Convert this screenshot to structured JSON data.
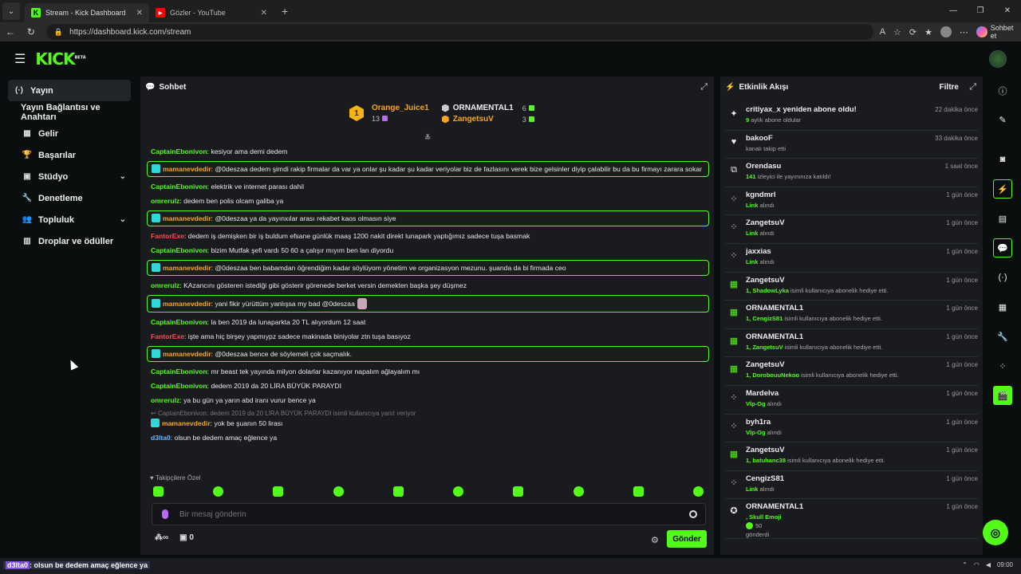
{
  "browser": {
    "tabs": [
      {
        "title": "Stream - Kick Dashboard",
        "active": true,
        "icon": "kick-icon"
      },
      {
        "title": "Gözler - YouTube",
        "active": false,
        "icon": "youtube-icon"
      }
    ],
    "url": "https://dashboard.kick.com/stream",
    "copilot_label": "Sohbet et"
  },
  "header": {
    "logo": "KICK",
    "logo_sup": "BETA"
  },
  "sidebar": {
    "items": [
      {
        "label": "Yayın",
        "icon": "broadcast-icon"
      },
      {
        "label": "Yayın Bağlantısı ve Anahtarı",
        "icon": ""
      },
      {
        "label": "Gelir",
        "icon": "revenue-icon"
      },
      {
        "label": "Başarılar",
        "icon": "trophy-icon"
      },
      {
        "label": "Stüdyo",
        "icon": "studio-icon"
      },
      {
        "label": "Denetleme",
        "icon": "wrench-icon"
      },
      {
        "label": "Topluluk",
        "icon": "community-icon"
      },
      {
        "label": "Droplar ve ödüller",
        "icon": "drops-icon"
      }
    ]
  },
  "chat": {
    "title": "Sohbet",
    "leaderboard": {
      "first": {
        "rank": "1",
        "name": "Orange_Juice1",
        "count": "13"
      },
      "second": {
        "name": "ORNAMENTAL1",
        "count": "6"
      },
      "third": {
        "name": "ZangetsuV",
        "count": "3"
      }
    },
    "messages": [
      {
        "user": "CaptainEbonivon",
        "text": ": kesiyor ama demi dedem"
      },
      {
        "user": "mamanevdedir",
        "text": ": @0deszaa dedem şimdi rakip firmalar da var ya onlar şu kadar şu kadar veriyolar biz de fazlasını verek bize gelsinler diyip çalabilir bu da bu firmayı zarara sokar"
      },
      {
        "user": "CaptainEbonivon",
        "text": ": elektrik ve internet parası dahil"
      },
      {
        "user": "omreruIz",
        "text": ": dedem ben polis olcam galiba ya"
      },
      {
        "user": "mamanevdedir",
        "text": ": @0deszaa ya da yayınxılar arası rekabet kaos olmasın siye"
      },
      {
        "user": "FantorExe",
        "text": ": dedem iş demişken bir iş buldum efsane günlük maaş 1200 nakit direkt lunapark yaptığımız sadece tuşa basmak"
      },
      {
        "user": "CaptainEbonivon",
        "text": ": bizim Mutfak şefi vardı 50 60 a çalışır mıyım ben lan diyordu"
      },
      {
        "user": "mamanevdedir",
        "text": ": @0deszaa ben babamdan öğrendiğim kadar söylüyom yönetim ve organizasyon mezunu. şuanda da bi firmada ceo"
      },
      {
        "user": "omreruIz",
        "text": ": KAzancını gösteren istediği gibi gösterir görenede berket versin demekten başka şey düşmez"
      },
      {
        "user": "mamanevdedir",
        "text": ": yani fikir yürüttüm yanlışsa my bad @0deszaa"
      },
      {
        "user": "CaptainEbonivon",
        "text": ": la ben 2019 da lunaparkta 20 TL alıyordum 12 saat"
      },
      {
        "user": "FantorExe",
        "text": ": işte ama hiç birşey yapmıypz sadece makinada biniyolar ztn tuşa basıyoz"
      },
      {
        "user": "mamanevdedir",
        "text": ": @0deszaa bence de söylemeli çok saçmalık."
      },
      {
        "user": "CaptainEbonivon",
        "text": ": mr beast tek yayında milyon dolarlar kazanıyor napalım ağlayalım mı"
      },
      {
        "user": "CaptainEbonivon",
        "text": ": dedem 2019 da 20 LİRA BÜYÜK PARAYDI"
      },
      {
        "user": "omreruIz",
        "text": ": ya bu gün ya yarın abd iranı vurur bence ya"
      },
      {
        "reply": "CaptainEbonivon: dedem 2019 da 20 LİRA BÜYÜK PARAYDI isimli kullanıcıya yanıt veriyor",
        "user": "mamanevdedir",
        "text": ": yok be şuanın 50 lirası"
      },
      {
        "user": "d3lta0",
        "text": ": olsun be dedem amaç eğlence ya"
      }
    ],
    "followers_only": "Takipçilere Özel",
    "input_placeholder": "Bir mesaj gönderin",
    "footer_count": "0",
    "send_label": "Gönder"
  },
  "activity": {
    "title": "Etkinlik Akışı",
    "filter": "Filtre",
    "items": [
      {
        "name": "critiyax_x yeniden abone oldu!",
        "time": "22 dakika önce",
        "hl": "9",
        "desc": " aylık abone oldular",
        "icon": "sparkle-icon"
      },
      {
        "name": "bakooF",
        "time": "33 dakika önce",
        "hl": "",
        "desc": "kanalı takip etti",
        "icon": "heart-icon"
      },
      {
        "name": "Orendasu",
        "time": "1 saat önce",
        "hl": "141",
        "desc": " izleyici ile yayınınıza katıldı!",
        "icon": "raid-icon"
      },
      {
        "name": "kgndmrl",
        "time": "1 gün önce",
        "hl": "Link",
        "desc": " alındı",
        "icon": "reward-icon"
      },
      {
        "name": "ZangetsuV",
        "time": "1 gün önce",
        "hl": "Link",
        "desc": " alındı",
        "icon": "reward-icon"
      },
      {
        "name": "jaxxias",
        "time": "1 gün önce",
        "hl": "Link",
        "desc": " alındı",
        "icon": "reward-icon"
      },
      {
        "name": "ZangetsuV",
        "time": "1 gün önce",
        "hl": "1, ShadowLyka",
        "desc": " isimli kullanıcıya abonelik hediye etti.",
        "icon": "gift-icon"
      },
      {
        "name": "ORNAMENTAL1",
        "time": "1 gün önce",
        "hl": "1, CengizS81",
        "desc": " isimli kullanıcıya abonelik hediye etti.",
        "icon": "gift-icon"
      },
      {
        "name": "ORNAMENTAL1",
        "time": "1 gün önce",
        "hl": "1, ZangetsuV",
        "desc": " isimli kullanıcıya abonelik hediye etti.",
        "icon": "gift-icon"
      },
      {
        "name": "ZangetsuV",
        "time": "1 gün önce",
        "hl": "1, DorobouuNekoo",
        "desc": " isimli kullanıcıya abonelik hediye etti.",
        "icon": "gift-icon"
      },
      {
        "name": "Mardelva",
        "time": "1 gün önce",
        "hl": "Vİp-Og",
        "desc": " alındı",
        "icon": "reward-icon"
      },
      {
        "name": "byh1ra",
        "time": "1 gün önce",
        "hl": "Vİp-Og",
        "desc": " alındı",
        "icon": "reward-icon"
      },
      {
        "name": "ZangetsuV",
        "time": "1 gün önce",
        "hl": "1, batuhanc38",
        "desc": " isimli kullanıcıya abonelik hediye etti.",
        "icon": "gift-icon"
      },
      {
        "name": "CengizS81",
        "time": "1 gün önce",
        "hl": "Link",
        "desc": " alındı",
        "icon": "reward-icon"
      }
    ],
    "last": {
      "name": "ORNAMENTAL1",
      "time": "1 gün önce",
      "hl": ", Skull Emoji",
      "amount": "50",
      "sent": "gönderdi"
    }
  },
  "overlay": {
    "user": "d3lta0",
    "text": ": olsun be dedem amaç eğlence ya"
  },
  "tray": {
    "time": "09:00"
  }
}
